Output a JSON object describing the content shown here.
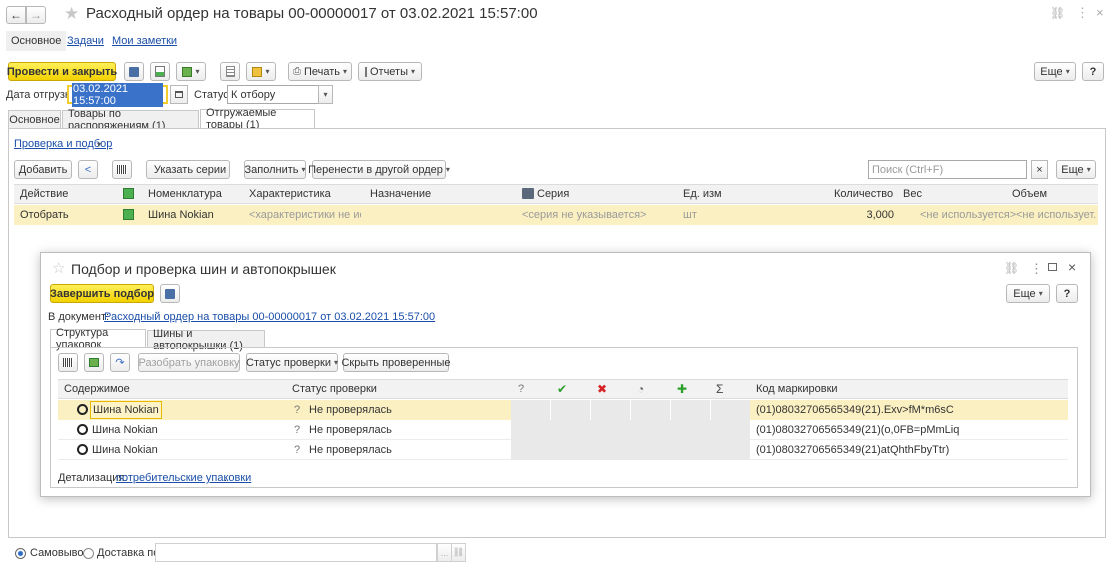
{
  "window": {
    "title": "Расходный ордер на товары 00-00000017 от 03.02.2021 15:57:00",
    "nav_tabs": [
      "Основное",
      "Задачи",
      "Мои заметки"
    ]
  },
  "toolbar": {
    "post_close": "Провести и закрыть",
    "print": "Печать",
    "reports": "Отчеты",
    "more": "Еще",
    "help": "?"
  },
  "header_fields": {
    "ship_date_label": "Дата отгрузки:",
    "ship_date_value": "03.02.2021 15:57:00",
    "status_label": "Статус:",
    "status_value": "К отбору"
  },
  "doc_tabs": [
    "Основное",
    "Товары по распоряжениям (1)",
    "Отгружаемые товары (1)"
  ],
  "check_link": "Проверка и подбор",
  "table_toolbar": {
    "add": "Добавить",
    "specify_series": "Указать серии",
    "fill": "Заполнить",
    "move": "Перенести в другой ордер",
    "search_placeholder": "Поиск (Ctrl+F)",
    "clear": "×",
    "more": "Еще"
  },
  "goods_table": {
    "columns": [
      "Действие",
      "Номенклатура",
      "Характеристика",
      "Назначение",
      "Серия",
      "Ед. изм",
      "Количество",
      "Вес",
      "Объем"
    ],
    "row": {
      "action": "Отобрать",
      "nomenclature": "Шина Nokian",
      "characteristic": "<характеристики не исп...",
      "purpose": "",
      "series": "<серия не указывается>",
      "unit": "шт",
      "quantity": "3,000",
      "weight": "<не используется>",
      "volume": "<не использует..."
    }
  },
  "dialog": {
    "title": "Подбор и проверка шин и автопокрышек",
    "finish": "Завершить подбор",
    "more": "Еще",
    "help": "?",
    "doc_label": "В документ:",
    "doc_link": "Расходный ордер на товары 00-00000017 от 03.02.2021 15:57:00",
    "tabs": [
      "Структура упаковок",
      "Шины и автопокрышки (1)"
    ],
    "buttons": {
      "unpack": "Разобрать упаковку",
      "check_status": "Статус проверки",
      "hide_checked": "Скрыть проверенные"
    },
    "columns": {
      "content": "Содержимое",
      "status": "Статус проверки",
      "question": "?",
      "check": "✔",
      "cross": "✖",
      "clock": "◔",
      "plus": "✚",
      "sigma": "Σ",
      "code": "Код маркировки"
    },
    "rows": [
      {
        "name": "Шина Nokian",
        "status_mark": "?",
        "status": "Не проверялась",
        "code": "(01)08032706565349(21).Exv>fM*m6sC"
      },
      {
        "name": "Шина Nokian",
        "status_mark": "?",
        "status": "Не проверялась",
        "code": "(01)08032706565349(21)(o,0FB=pMmLiq"
      },
      {
        "name": "Шина Nokian",
        "status_mark": "?",
        "status": "Не проверялась",
        "code": "(01)08032706565349(21)atQhthFbyTtr)"
      }
    ],
    "detail_label": "Детализация:",
    "detail_link": "потребительские упаковки",
    "detail_dot": "."
  },
  "footer": {
    "pickup": "Самовывоз",
    "delivery": "Доставка по",
    "more_dots": "...",
    "link_icon": "link-icon"
  },
  "colors": {
    "accent_yellow": "#f5d90a",
    "selected_row": "#fbf0c2",
    "link": "#1a4ea8",
    "green_check": "#2aa02a",
    "red_cross": "#d62222"
  }
}
